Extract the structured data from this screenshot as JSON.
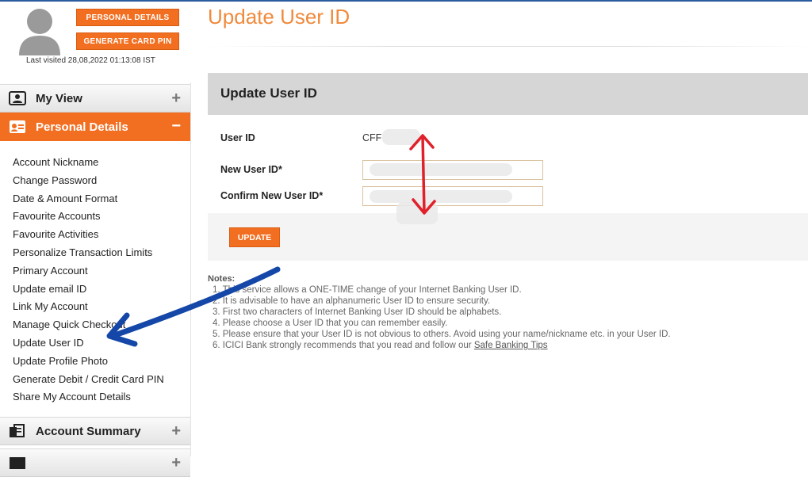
{
  "profile": {
    "personal_details_btn": "PERSONAL DETAILS",
    "generate_pin_btn": "GENERATE CARD PIN",
    "last_visited": "Last visited 28,08,2022 01:13:08 IST"
  },
  "sidebar": {
    "my_view": "My View",
    "personal_details": "Personal Details",
    "account_summary": "Account Summary",
    "items": [
      "Account Nickname",
      "Change Password",
      "Date & Amount Format",
      "Favourite Accounts",
      "Favourite Activities",
      "Personalize Transaction Limits",
      "Primary Account",
      "Update email ID",
      "Link My Account",
      "Manage Quick Checkout",
      "Update User ID",
      "Update Profile Photo",
      "Generate Debit / Credit Card PIN",
      "Share My Account Details"
    ]
  },
  "main": {
    "page_title": "Update User ID",
    "panel_title": "Update User ID",
    "user_id_label": "User ID",
    "user_id_value": "CFF",
    "new_user_id_label": "New User ID*",
    "confirm_user_id_label": "Confirm New User ID*",
    "update_btn": "UPDATE"
  },
  "notes": {
    "title": "Notes:",
    "items": [
      "1. This service allows a ONE-TIME change of your Internet Banking User ID.",
      "2. It is advisable to have an alphanumeric User ID to ensure security.",
      "3. First two characters of Internet Banking User ID should be alphabets.",
      "4. Please choose a User ID that you can remember easily.",
      "5. Please ensure that your User ID is not obvious to others. Avoid using your name/nickname etc. in your User ID."
    ],
    "last_prefix": "6. ICICI Bank strongly recommends that you read and follow our ",
    "last_link": "Safe Banking Tips"
  },
  "colors": {
    "accent": "#f26f21",
    "title": "#f08a3c",
    "annotation_red": "#e0202a",
    "annotation_blue": "#1447a8"
  }
}
